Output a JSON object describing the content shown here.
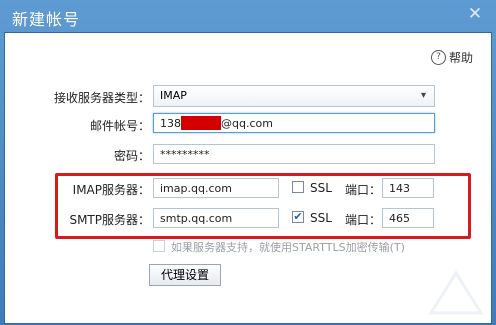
{
  "window": {
    "title": "新建帐号"
  },
  "help": {
    "label": "帮助"
  },
  "form": {
    "server_type_label": "接收服务器类型：",
    "server_type_value": "IMAP",
    "account_label": "邮件帐号：",
    "account_prefix": "138",
    "account_suffix": "@qq.com",
    "password_label": "密码：",
    "password_value": "*********",
    "imap_label": "IMAP服务器：",
    "imap_value": "imap.qq.com",
    "imap_ssl_label": "SSL",
    "imap_ssl_checked": false,
    "imap_port_label": "端口：",
    "imap_port_value": "143",
    "smtp_label": "SMTP服务器：",
    "smtp_value": "smtp.qq.com",
    "smtp_ssl_label": "SSL",
    "smtp_ssl_checked": true,
    "smtp_port_label": "端口：",
    "smtp_port_value": "465",
    "starttls_label": "如果服务器支持，就使用STARTTLS加密传输(T)",
    "proxy_button": "代理设置"
  },
  "colors": {
    "highlight": "#d61b1b",
    "redaction": "#d40000",
    "titlebar": "#4a86c0"
  },
  "icons": {
    "help": "help-circle-icon",
    "close": "close-icon",
    "dropdown": "chevron-down-icon",
    "check": "checkmark-icon"
  }
}
